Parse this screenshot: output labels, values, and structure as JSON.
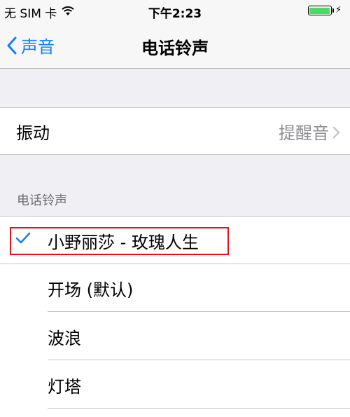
{
  "status_bar": {
    "carrier": "无 SIM 卡",
    "time": "下午2:23",
    "battery_level": 1.0,
    "battery_color": "#4cd964"
  },
  "nav": {
    "back_label": "声音",
    "title": "电话铃声",
    "accent_color": "#157efb"
  },
  "vibration": {
    "label": "振动",
    "value": "提醒音"
  },
  "ringtones": {
    "header": "电话铃声",
    "items": [
      {
        "label": "小野丽莎 - 玫瑰人生",
        "selected": true
      },
      {
        "label": "开场 (默认)",
        "selected": false
      },
      {
        "label": "波浪",
        "selected": false
      },
      {
        "label": "灯塔",
        "selected": false
      }
    ]
  },
  "annotation_color": "#e0141e"
}
